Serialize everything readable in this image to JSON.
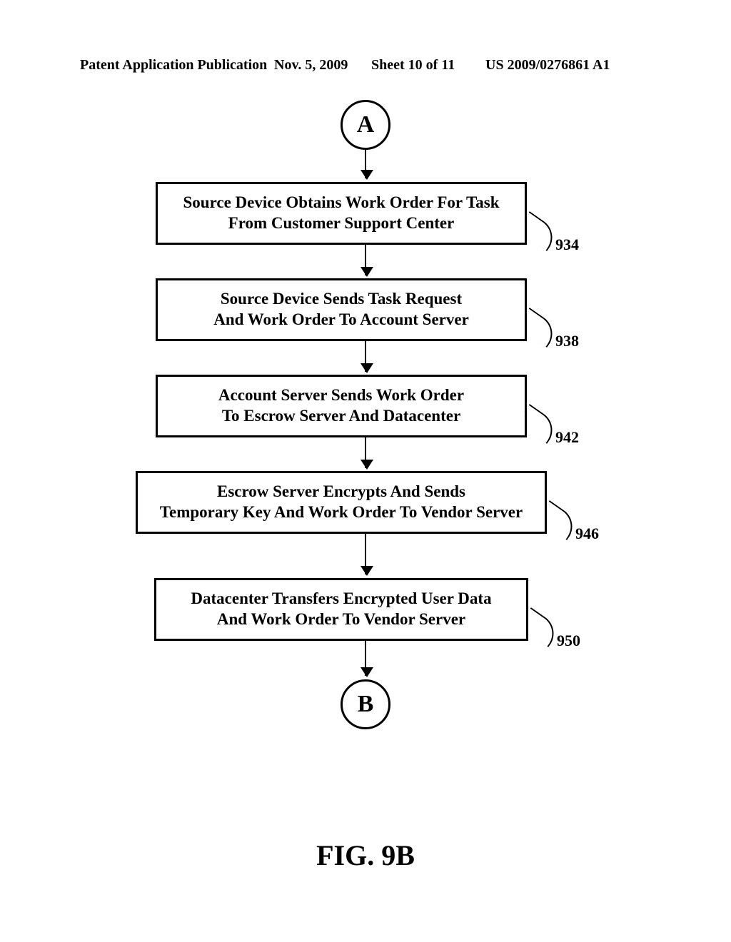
{
  "header": {
    "publication": "Patent Application Publication",
    "date": "Nov. 5, 2009",
    "sheet": "Sheet 10 of 11",
    "number": "US 2009/0276861 A1"
  },
  "connectors": {
    "start": "A",
    "end": "B"
  },
  "steps": [
    {
      "ref": "934",
      "text_l1": "Source Device Obtains Work Order For Task",
      "text_l2": "From Customer Support Center"
    },
    {
      "ref": "938",
      "text_l1": "Source Device Sends Task Request",
      "text_l2": "And Work Order To Account Server"
    },
    {
      "ref": "942",
      "text_l1": "Account Server Sends Work Order",
      "text_l2": "To Escrow Server And Datacenter"
    },
    {
      "ref": "946",
      "text_l1": "Escrow Server Encrypts And Sends",
      "text_l2": "Temporary Key And Work Order To Vendor Server"
    },
    {
      "ref": "950",
      "text_l1": "Datacenter Transfers Encrypted User Data",
      "text_l2": "And Work Order To Vendor Server"
    }
  ],
  "figure_label": "FIG. 9B",
  "chart_data": {
    "type": "flowchart",
    "direction": "top-down",
    "nodes": [
      {
        "id": "A",
        "kind": "off-page-connector",
        "label": "A"
      },
      {
        "id": "934",
        "kind": "process",
        "label": "Source Device Obtains Work Order For Task From Customer Support Center"
      },
      {
        "id": "938",
        "kind": "process",
        "label": "Source Device Sends Task Request And Work Order To Account Server"
      },
      {
        "id": "942",
        "kind": "process",
        "label": "Account Server Sends Work Order To Escrow Server And Datacenter"
      },
      {
        "id": "946",
        "kind": "process",
        "label": "Escrow Server Encrypts And Sends Temporary Key And Work Order To Vendor Server"
      },
      {
        "id": "950",
        "kind": "process",
        "label": "Datacenter Transfers Encrypted User Data And Work Order To Vendor Server"
      },
      {
        "id": "B",
        "kind": "off-page-connector",
        "label": "B"
      }
    ],
    "edges": [
      {
        "from": "A",
        "to": "934"
      },
      {
        "from": "934",
        "to": "938"
      },
      {
        "from": "938",
        "to": "942"
      },
      {
        "from": "942",
        "to": "946"
      },
      {
        "from": "946",
        "to": "950"
      },
      {
        "from": "950",
        "to": "B"
      }
    ],
    "figure": "FIG. 9B"
  }
}
